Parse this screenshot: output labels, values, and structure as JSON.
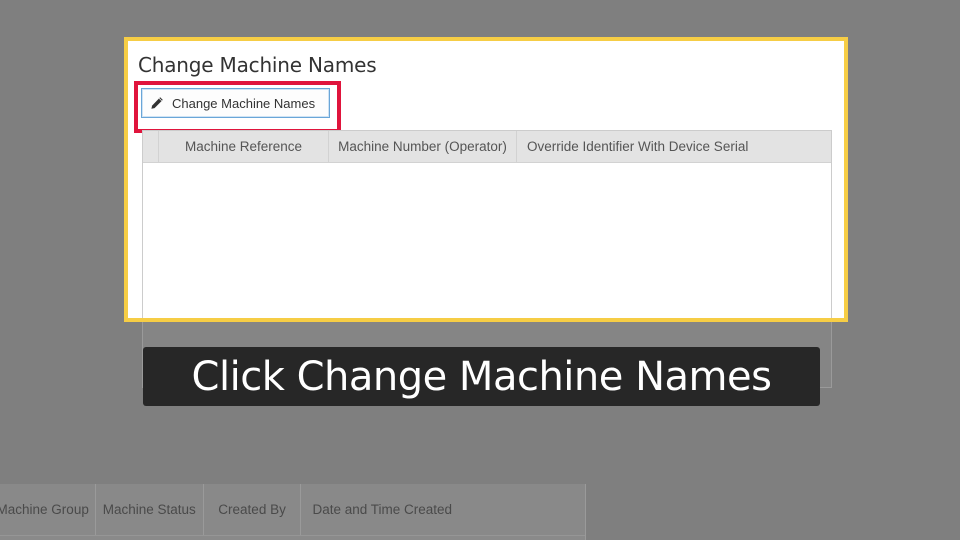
{
  "dialog": {
    "title": "Change Machine Names",
    "change_button_label": "Change Machine Names",
    "columns": [
      "Machine Reference",
      "Machine Number (Operator)",
      "Override Identifier With Device Serial"
    ]
  },
  "background_table": {
    "columns": [
      "Machine Group",
      "Machine Status",
      "Created By",
      "Date and Time Created"
    ]
  },
  "caption": {
    "text": "Click Change Machine Names"
  },
  "colors": {
    "highlight_border": "#f6cd45",
    "button_callout": "#e0143c",
    "overlay": "#7f7f7f",
    "caption_bg": "#272727"
  },
  "icons": {
    "edit": "pencil-icon"
  }
}
